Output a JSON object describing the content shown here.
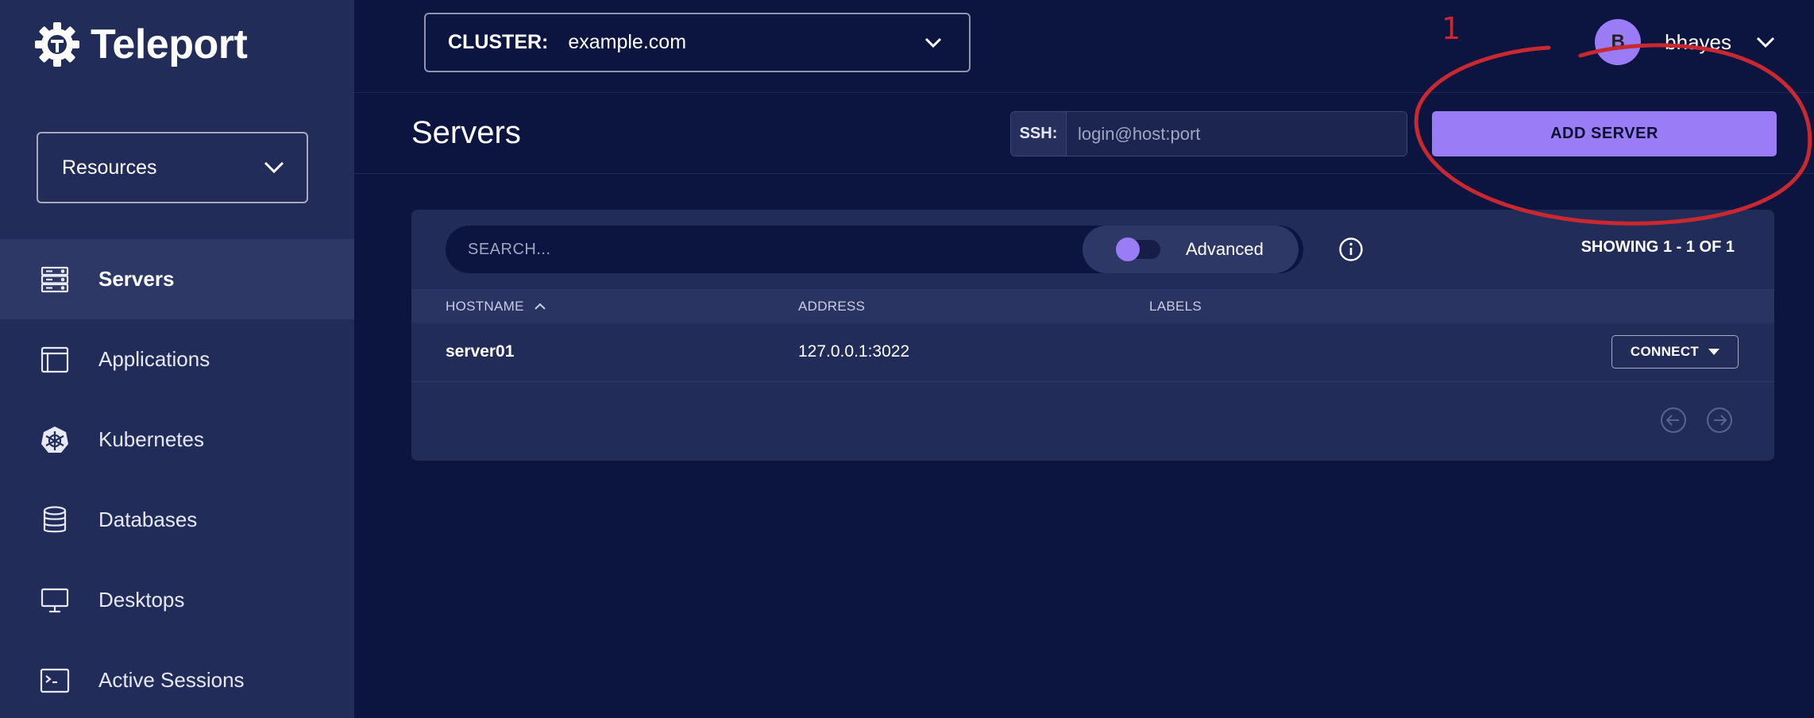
{
  "app": {
    "name": "Teleport",
    "accent_color": "#9b7cf7",
    "annotation_color": "#c8282f"
  },
  "sidebar": {
    "resources_select": {
      "value": "Resources",
      "icon": "chevron-down-icon"
    },
    "items": [
      {
        "label": "Servers",
        "icon": "server-icon",
        "active": true
      },
      {
        "label": "Applications",
        "icon": "application-window-icon",
        "active": false
      },
      {
        "label": "Kubernetes",
        "icon": "kubernetes-icon",
        "active": false
      },
      {
        "label": "Databases",
        "icon": "database-icon",
        "active": false
      },
      {
        "label": "Desktops",
        "icon": "desktop-icon",
        "active": false
      },
      {
        "label": "Active Sessions",
        "icon": "terminal-icon",
        "active": false
      }
    ]
  },
  "topbar": {
    "cluster_label": "CLUSTER:",
    "cluster_value": "example.com",
    "user": {
      "initial": "B",
      "name": "bhayes"
    }
  },
  "page": {
    "title": "Servers",
    "ssh_label": "SSH:",
    "ssh_placeholder": "login@host:port",
    "add_button": "ADD SERVER"
  },
  "annotation": {
    "number": "1"
  },
  "table": {
    "search_placeholder": "SEARCH...",
    "advanced_label": "Advanced",
    "showing_prefix": "SHOWING",
    "showing_range": "1 - 1",
    "showing_of": "OF",
    "showing_total": "1",
    "columns": [
      "HOSTNAME",
      "ADDRESS",
      "LABELS"
    ],
    "rows": [
      {
        "hostname": "server01",
        "address": "127.0.0.1:3022",
        "labels": "",
        "action": "CONNECT"
      }
    ]
  }
}
